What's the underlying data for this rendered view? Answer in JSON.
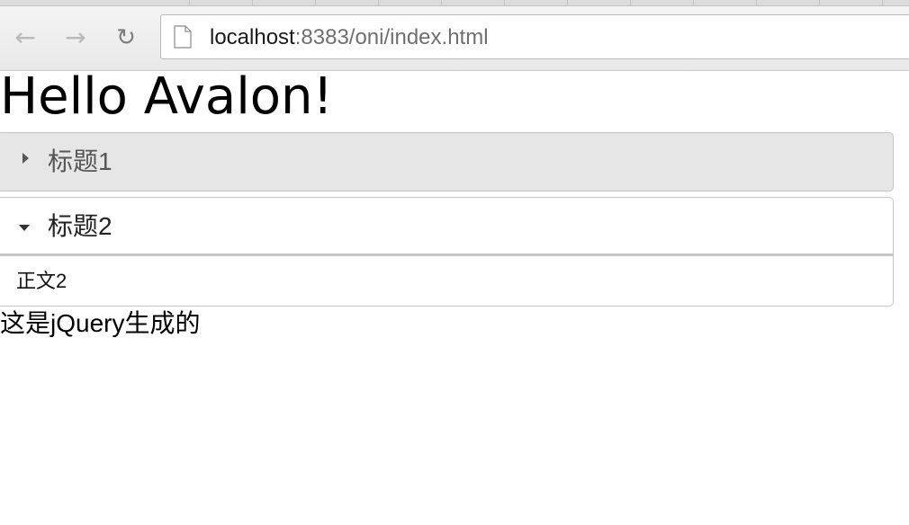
{
  "browser": {
    "back_icon": "arrow-left-icon",
    "forward_icon": "arrow-right-icon",
    "reload_icon": "reload-icon",
    "page_icon": "document-icon",
    "url_host": "localhost",
    "url_path": ":8383/oni/index.html"
  },
  "page": {
    "title": "Hello Avalon!",
    "accordion": [
      {
        "label": "标题1",
        "expanded": false
      },
      {
        "label": "标题2",
        "expanded": true,
        "content": "正文2"
      }
    ],
    "jquery_text": "这是jQuery生成的"
  },
  "colors": {
    "collapsed_header_bg": "#e6e6e6",
    "border": "#c6c6c6"
  }
}
